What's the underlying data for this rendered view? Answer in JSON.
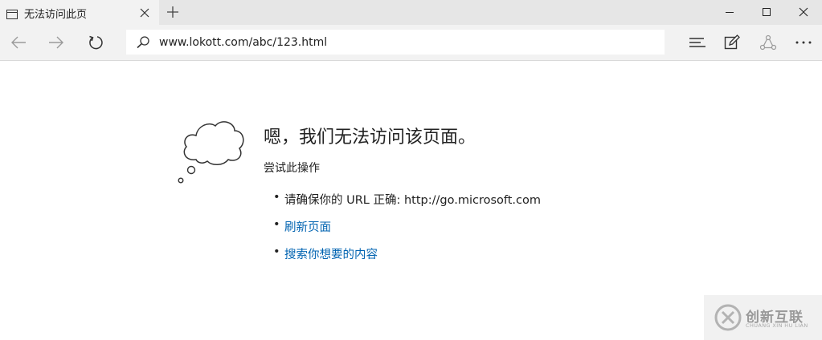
{
  "tab": {
    "title": "无法访问此页"
  },
  "address_bar": {
    "url": "www.lokott.com/abc/123.html"
  },
  "error": {
    "heading": "嗯，我们无法访问该页面。",
    "subheading": "尝试此操作",
    "suggestions": [
      {
        "text": "请确保你的 URL 正确: http://go.microsoft.com"
      },
      {
        "link": "刷新页面"
      },
      {
        "link": "搜索你想要的内容"
      }
    ]
  },
  "icons": {
    "tab": "page-icon",
    "close": "close-icon",
    "new_tab": "plus-icon",
    "minimize": "minimize-icon",
    "maximize": "maximize-icon",
    "window_close": "window-close-icon",
    "back": "back-arrow-icon",
    "forward": "forward-arrow-icon",
    "refresh": "refresh-icon",
    "search": "search-icon",
    "hub": "hub-icon",
    "note": "web-note-icon",
    "share": "share-icon",
    "more": "more-icon",
    "illustration": "thought-cloud-icon"
  },
  "colors": {
    "link": "#0063b1",
    "tabbar": "#e6e6e6",
    "navbar": "#f2f2f2"
  },
  "watermark": {
    "text": "创新互联",
    "subtitle": "CHUANG XIN HU LIAN"
  }
}
